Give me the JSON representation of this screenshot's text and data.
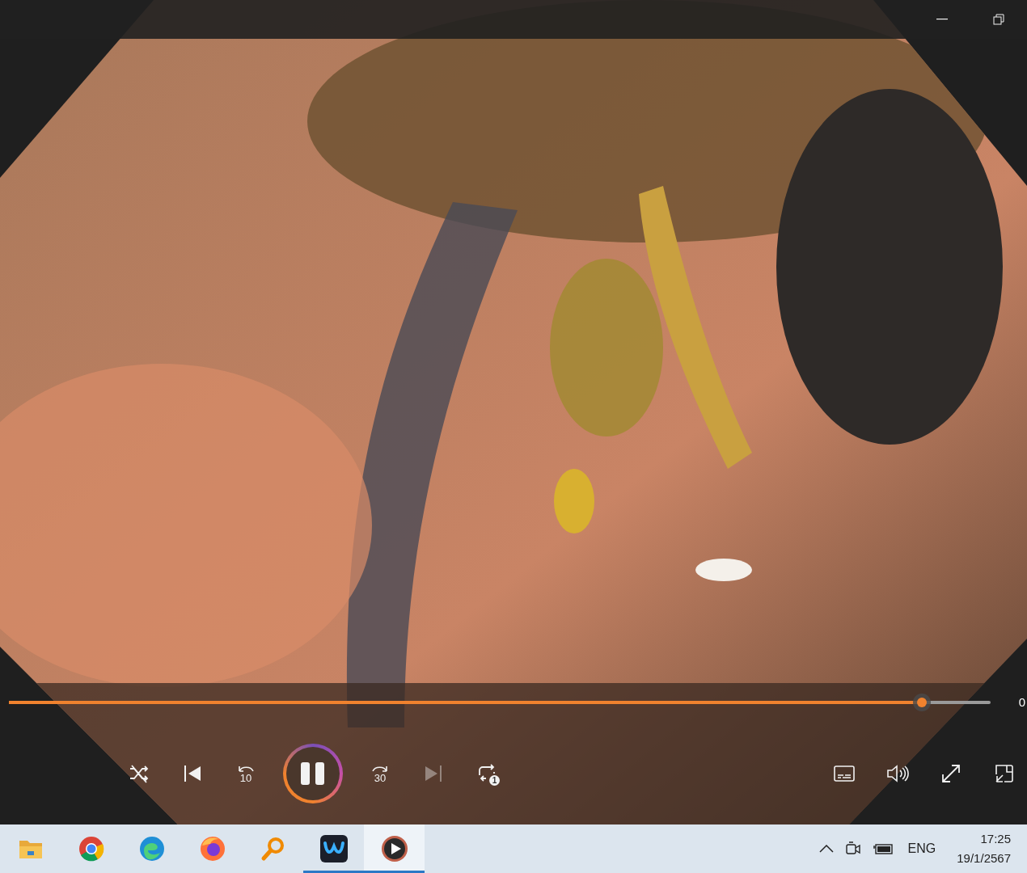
{
  "player": {
    "playing": true,
    "next_disabled": true,
    "seek": {
      "level": 0.93
    },
    "time": "0",
    "rewind_label": "10",
    "forward_label": "30",
    "repeat_label": "1"
  },
  "taskbar": {
    "apps": [
      {
        "kind": "folder",
        "running": false,
        "selected": false
      },
      {
        "kind": "ring",
        "running": false,
        "selected": false
      },
      {
        "kind": "wave",
        "running": false,
        "selected": false
      },
      {
        "kind": "fox",
        "running": false,
        "selected": false
      },
      {
        "kind": "magnifier",
        "running": false,
        "selected": false
      },
      {
        "kind": "tile",
        "running": true,
        "selected": false
      },
      {
        "kind": "player",
        "running": true,
        "selected": true
      }
    ],
    "tray": {
      "language": "ENG",
      "time": "17:25",
      "date": "19/1/2567"
    }
  }
}
